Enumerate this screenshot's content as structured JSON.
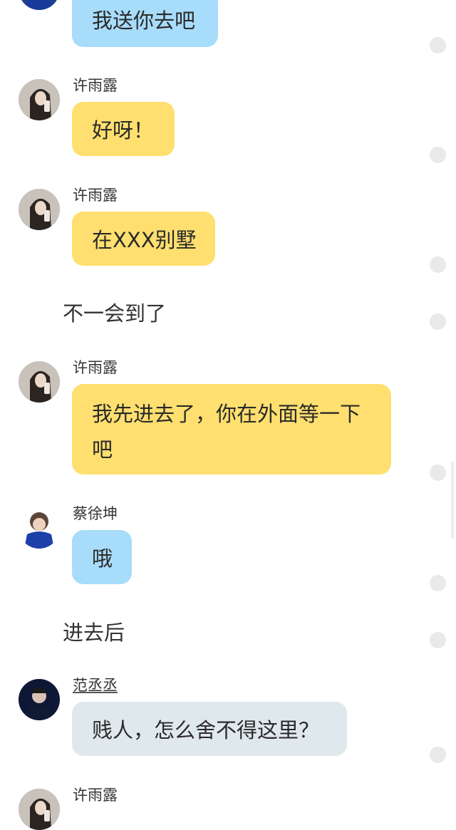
{
  "messages": [
    {
      "type": "bubble",
      "color": "blue",
      "avatar": "avatar-caixukun",
      "name": "",
      "text": "我送你去吧"
    },
    {
      "type": "bubble",
      "color": "yellow",
      "avatar": "avatar-xuyulu",
      "name": "许雨露",
      "text": "好呀！"
    },
    {
      "type": "bubble",
      "color": "yellow",
      "avatar": "avatar-xuyulu",
      "name": "许雨露",
      "text": "在XXX别墅"
    },
    {
      "type": "narration",
      "text": "不一会到了"
    },
    {
      "type": "bubble",
      "color": "yellow",
      "avatar": "avatar-xuyulu",
      "name": "许雨露",
      "text": "我先进去了，你在外面等一下吧"
    },
    {
      "type": "bubble",
      "color": "blue",
      "avatar": "avatar-caixukun",
      "name": "蔡徐坤",
      "text": "哦"
    },
    {
      "type": "narration",
      "text": "进去后"
    },
    {
      "type": "bubble",
      "color": "gray",
      "avatar": "avatar-fanchengcheng",
      "name": "范丞丞",
      "text": "贱人，怎么舍不得这里？"
    },
    {
      "type": "bubble",
      "color": "yellow",
      "avatar": "avatar-xuyulu",
      "name": "许雨露",
      "text": ""
    }
  ],
  "colors": {
    "blue_bubble": "#a7dcfa",
    "yellow_bubble": "#fedf6f",
    "gray_bubble": "#dfe8ed",
    "action_dot": "#e9e9e9"
  }
}
